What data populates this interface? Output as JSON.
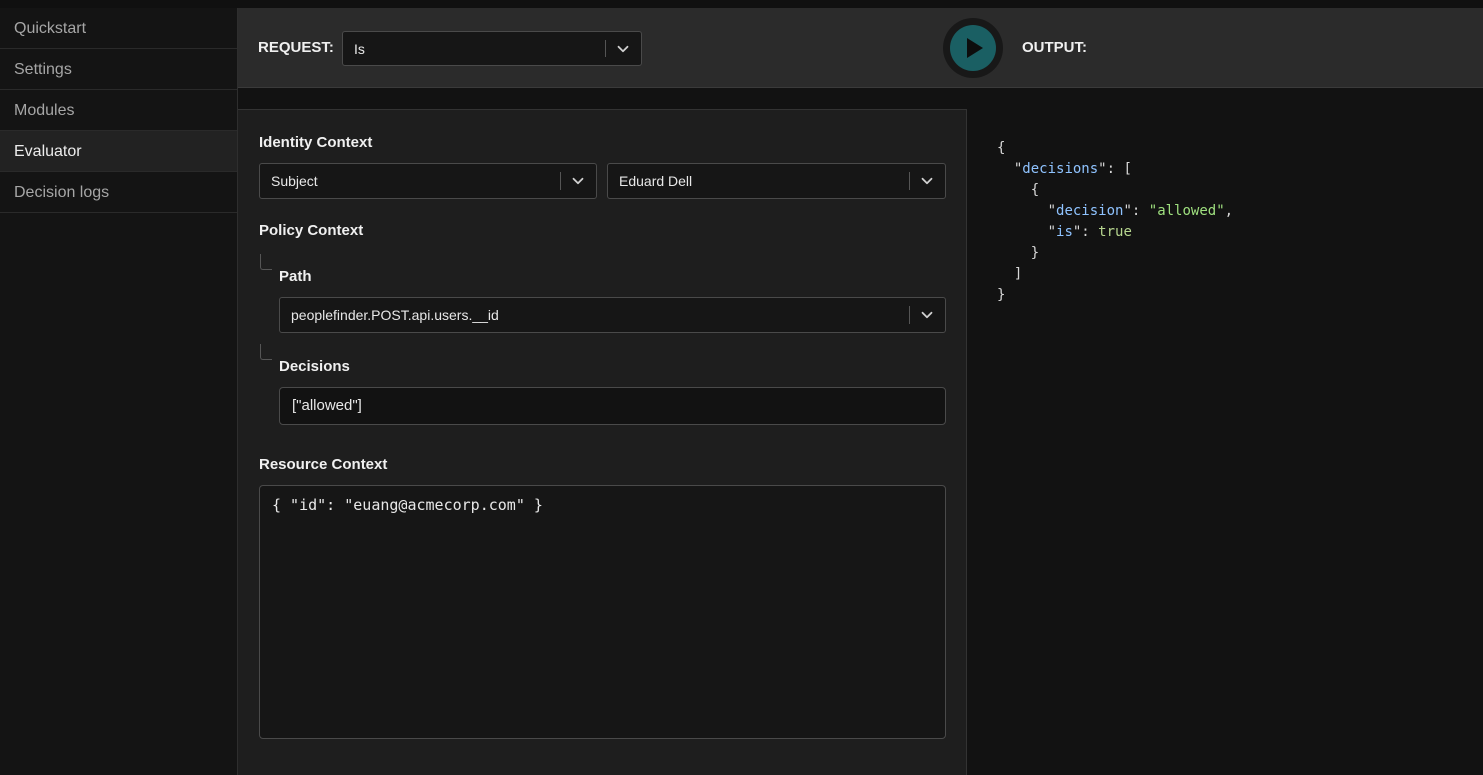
{
  "sidebar": {
    "items": [
      {
        "label": "Quickstart"
      },
      {
        "label": "Settings"
      },
      {
        "label": "Modules"
      },
      {
        "label": "Evaluator"
      },
      {
        "label": "Decision logs"
      }
    ],
    "active": "Evaluator"
  },
  "header": {
    "request_label": "REQUEST:",
    "request_value": "Is",
    "output_label": "OUTPUT:",
    "run_icon": "play-icon"
  },
  "form": {
    "identity": {
      "title": "Identity Context",
      "type_value": "Subject",
      "user_value": "Eduard Dell"
    },
    "policy": {
      "title": "Policy Context",
      "path_label": "Path",
      "path_value": "peoplefinder.POST.api.users.__id",
      "decisions_label": "Decisions",
      "decisions_value": "[\"allowed\"]"
    },
    "resource": {
      "title": "Resource Context",
      "value": "{ \"id\": \"euang@acmecorp.com\" }"
    }
  },
  "output": {
    "decisions_key": "decisions",
    "decision_key": "decision",
    "decision_value": "allowed",
    "is_key": "is",
    "is_value": "true"
  },
  "colors": {
    "accent": "#1a5f63",
    "json_key": "#8fc3ff",
    "json_string": "#9fe07f"
  }
}
